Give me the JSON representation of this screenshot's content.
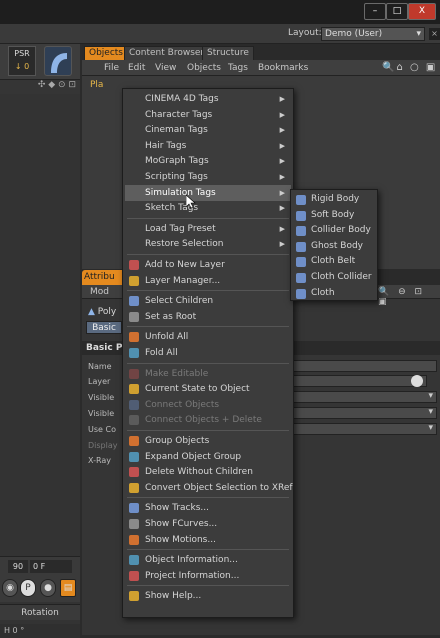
{
  "window": {
    "minimize": "–",
    "maximize": "□",
    "close": "X"
  },
  "layout": {
    "label": "Layout:",
    "value": "Demo (User)",
    "close": "×"
  },
  "left_panel": {
    "psr_label": "PSR",
    "psr_value": "↓ 0",
    "tools": "✣ ◆ ⊙ ⊡",
    "time_value": "90",
    "time_frames": "0 F",
    "transport_play": "P",
    "rotation_label": "Rotation",
    "h_field": "H 0 °"
  },
  "objects_panel": {
    "tabs": [
      "Objects",
      "Content Browser",
      "Structure"
    ],
    "menu": [
      "File",
      "Edit",
      "View",
      "Objects",
      "Tags",
      "Bookmarks"
    ],
    "icons": "🔍⌂ ○ ▣",
    "row_label": "Pla"
  },
  "attributes_panel": {
    "tab": "Attribu",
    "mode_label": "Mod",
    "object_label": "Poly",
    "basic_tab": "Basic",
    "basic_props": "Basic Pro",
    "properties": [
      {
        "label": "Name"
      },
      {
        "label": "Layer"
      },
      {
        "label": "Visible"
      },
      {
        "label": "Visible"
      },
      {
        "label": "Use Co"
      },
      {
        "label": "Display"
      },
      {
        "label": "X-Ray"
      }
    ],
    "right_icons": "🔍 ⊖ ⊡ ▣"
  },
  "context_menu": {
    "items": [
      {
        "label": "CINEMA 4D Tags",
        "submenu": true
      },
      {
        "label": "Character Tags",
        "submenu": true
      },
      {
        "label": "Cineman Tags",
        "submenu": true
      },
      {
        "label": "Hair Tags",
        "submenu": true
      },
      {
        "label": "MoGraph Tags",
        "submenu": true
      },
      {
        "label": "Scripting Tags",
        "submenu": true
      },
      {
        "label": "Simulation Tags",
        "submenu": true,
        "highlighted": true
      },
      {
        "label": "Sketch Tags",
        "submenu": true
      },
      {
        "separator": true
      },
      {
        "label": "Load Tag Preset",
        "submenu": true
      },
      {
        "label": "Restore Selection",
        "submenu": true
      },
      {
        "separator": true
      },
      {
        "label": "Add to New Layer",
        "icon": true
      },
      {
        "label": "Layer Manager...",
        "icon": true
      },
      {
        "separator": true
      },
      {
        "label": "Select Children",
        "icon": true
      },
      {
        "label": "Set as Root",
        "icon": true
      },
      {
        "separator": true
      },
      {
        "label": "Unfold All",
        "icon": true
      },
      {
        "label": "Fold All",
        "icon": true
      },
      {
        "separator": true
      },
      {
        "label": "Make Editable",
        "icon": true,
        "disabled": true
      },
      {
        "label": "Current State to Object",
        "icon": true
      },
      {
        "label": "Connect Objects",
        "icon": true,
        "disabled": true
      },
      {
        "label": "Connect Objects + Delete",
        "icon": true,
        "disabled": true
      },
      {
        "separator": true
      },
      {
        "label": "Group Objects",
        "icon": true
      },
      {
        "label": "Expand Object Group",
        "icon": true
      },
      {
        "label": "Delete Without Children",
        "icon": true
      },
      {
        "label": "Convert Object Selection to XRef",
        "icon": true
      },
      {
        "separator": true
      },
      {
        "label": "Show Tracks...",
        "icon": true
      },
      {
        "label": "Show FCurves...",
        "icon": true
      },
      {
        "label": "Show Motions...",
        "icon": true
      },
      {
        "separator": true
      },
      {
        "label": "Object Information...",
        "icon": true
      },
      {
        "label": "Project Information...",
        "icon": true
      },
      {
        "separator": true
      },
      {
        "label": "Show Help...",
        "icon": true
      }
    ]
  },
  "submenu": {
    "items": [
      "Rigid Body",
      "Soft Body",
      "Collider Body",
      "Ghost Body",
      "Cloth Belt",
      "Cloth Collider",
      "Cloth"
    ]
  }
}
